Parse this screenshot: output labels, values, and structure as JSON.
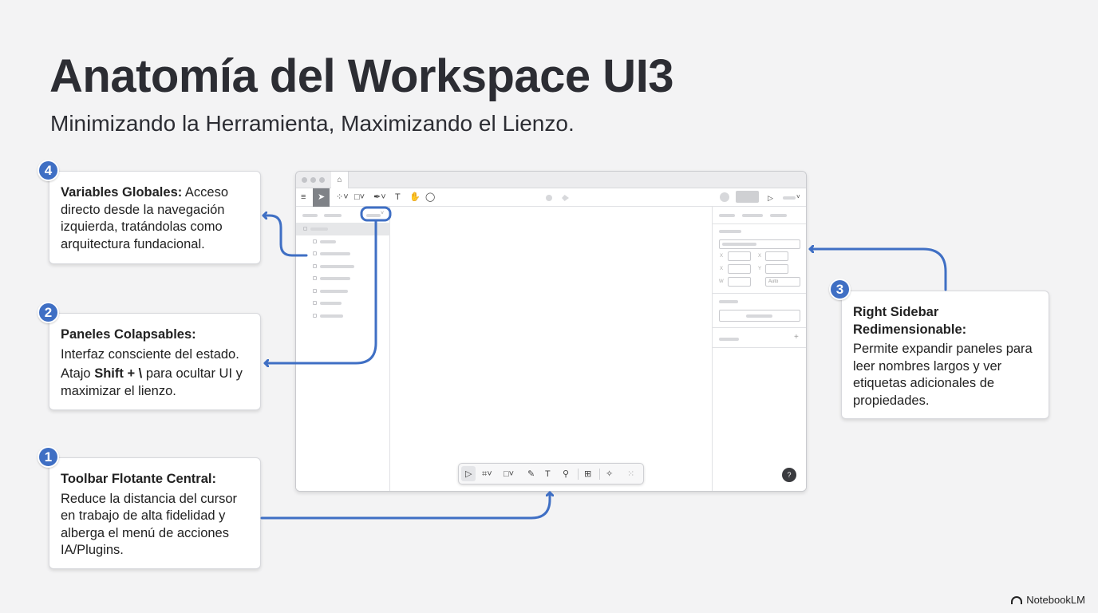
{
  "title": "Anatomía del Workspace UI3",
  "subtitle": "Minimizando la Herramienta, Maximizando el Lienzo.",
  "callouts": {
    "c4": {
      "number": "4",
      "heading": "Variables Globales:",
      "text": " Acceso directo desde la navegación izquierda, tratándolas como arquitectura fundacional."
    },
    "c2": {
      "number": "2",
      "heading": "Paneles Colapsables:",
      "line1": "Interfaz consciente del estado.",
      "prefix": "Atajo ",
      "shortcut": "Shift + \\",
      "suffix": " para ocultar UI y maximizar el lienzo."
    },
    "c1": {
      "number": "1",
      "heading": "Toolbar Flotante Central:",
      "text": "Reduce la distancia del cursor en trabajo de alta fidelidad y alberga el menú de acciones IA/Plugins."
    },
    "c3": {
      "number": "3",
      "heading": "Right Sidebar Redimensionable:",
      "text": "Permite expandir paneles para leer nombres largos y ver etiquetas adicionales de propiedades."
    }
  },
  "mock": {
    "field_labels": [
      "X",
      "X",
      "X",
      "Y",
      "W"
    ],
    "select_label": "Auto",
    "help": "?"
  },
  "brand": "NotebookLM",
  "colors": {
    "accent": "#3f6fc4",
    "background": "#f3f3f4",
    "text": "#2c2d33"
  }
}
